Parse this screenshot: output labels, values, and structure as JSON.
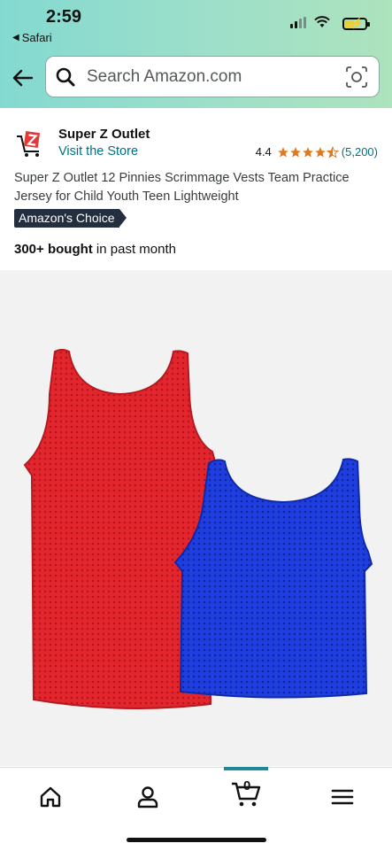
{
  "status_bar": {
    "time": "2:59",
    "back_app": "Safari"
  },
  "search": {
    "placeholder": "Search Amazon.com"
  },
  "store": {
    "name": "Super Z Outlet",
    "link_label": "Visit the Store",
    "rating": "4.4",
    "rating_fraction": 0.88,
    "review_count": "(5,200)"
  },
  "product": {
    "title": "Super Z Outlet 12 Pinnies Scrimmage Vests Team Practice Jersey for Child Youth Teen Lightweight",
    "badge": "Amazon's Choice",
    "bought_strong": "300+ bought",
    "bought_rest": " in past month"
  },
  "bottom_nav": {
    "items": [
      "home-icon",
      "account-icon",
      "cart-icon",
      "menu-icon"
    ],
    "cart_count": "0",
    "active": "cart"
  },
  "colors": {
    "header_gradient_start": "#83d9d1",
    "header_gradient_end": "#ade3bd",
    "link": "#007185",
    "star": "#de7921",
    "badge_bg": "#232f3e",
    "jersey_red": "#d8242c",
    "jersey_blue": "#1a3fd6"
  }
}
